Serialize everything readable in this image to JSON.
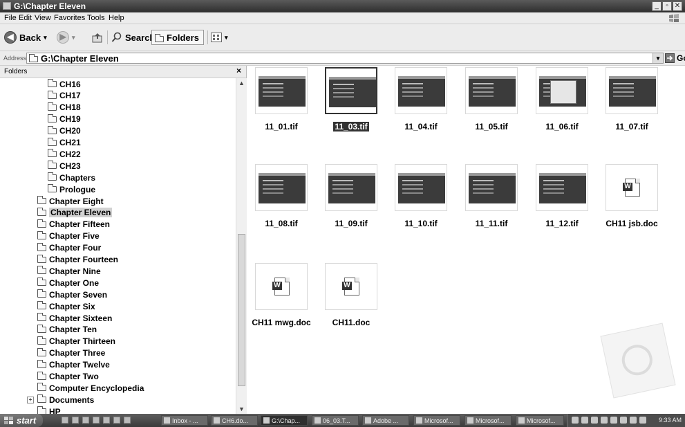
{
  "window": {
    "title": "G:\\Chapter Eleven"
  },
  "menu": [
    "File",
    "Edit",
    "View",
    "Favorites",
    "Tools",
    "Help"
  ],
  "toolbar": {
    "back": "Back",
    "search": "Search",
    "folders": "Folders"
  },
  "address": {
    "label": "Address",
    "value": "G:\\Chapter Eleven",
    "go": "Go"
  },
  "folders_pane": {
    "title": "Folders",
    "items": [
      {
        "label": "CH16",
        "level": 2
      },
      {
        "label": "CH17",
        "level": 2
      },
      {
        "label": "CH18",
        "level": 2
      },
      {
        "label": "CH19",
        "level": 2
      },
      {
        "label": "CH20",
        "level": 2
      },
      {
        "label": "CH21",
        "level": 2
      },
      {
        "label": "CH22",
        "level": 2
      },
      {
        "label": "CH23",
        "level": 2
      },
      {
        "label": "Chapters",
        "level": 2
      },
      {
        "label": "Prologue",
        "level": 2
      },
      {
        "label": "Chapter Eight",
        "level": 1
      },
      {
        "label": "Chapter Eleven",
        "level": 1,
        "selected": true
      },
      {
        "label": "Chapter Fifteen",
        "level": 1
      },
      {
        "label": "Chapter Five",
        "level": 1
      },
      {
        "label": "Chapter Four",
        "level": 1
      },
      {
        "label": "Chapter Fourteen",
        "level": 1
      },
      {
        "label": "Chapter Nine",
        "level": 1
      },
      {
        "label": "Chapter One",
        "level": 1
      },
      {
        "label": "Chapter Seven",
        "level": 1
      },
      {
        "label": "Chapter Six",
        "level": 1
      },
      {
        "label": "Chapter Sixteen",
        "level": 1
      },
      {
        "label": "Chapter Ten",
        "level": 1
      },
      {
        "label": "Chapter Thirteen",
        "level": 1
      },
      {
        "label": "Chapter Three",
        "level": 1
      },
      {
        "label": "Chapter Twelve",
        "level": 1
      },
      {
        "label": "Chapter Two",
        "level": 1
      },
      {
        "label": "Computer Encyclopedia",
        "level": 1
      },
      {
        "label": "Documents",
        "level": 1,
        "expandable": true
      },
      {
        "label": "HP",
        "level": 1
      }
    ]
  },
  "files": [
    {
      "name": "11_01.tif",
      "type": "image"
    },
    {
      "name": "11_03.tif",
      "type": "image",
      "selected": true
    },
    {
      "name": "11_04.tif",
      "type": "image"
    },
    {
      "name": "11_05.tif",
      "type": "image"
    },
    {
      "name": "11_06.tif",
      "type": "image-dialog"
    },
    {
      "name": "11_07.tif",
      "type": "image"
    },
    {
      "name": "11_08.tif",
      "type": "image"
    },
    {
      "name": "11_09.tif",
      "type": "image"
    },
    {
      "name": "11_10.tif",
      "type": "image"
    },
    {
      "name": "11_11.tif",
      "type": "image"
    },
    {
      "name": "11_12.tif",
      "type": "image"
    },
    {
      "name": "CH11 jsb.doc",
      "type": "word-doc"
    },
    {
      "name": "CH11 mwg.doc",
      "type": "word-doc"
    },
    {
      "name": "CH11.doc",
      "type": "word-doc"
    }
  ],
  "taskbar": {
    "start": "start",
    "tasks": [
      {
        "label": "Inbox - ..."
      },
      {
        "label": "CH6.do..."
      },
      {
        "label": "G:\\Chap...",
        "active": true
      },
      {
        "label": "06_03.T..."
      },
      {
        "label": "Adobe ..."
      },
      {
        "label": "Microsof..."
      },
      {
        "label": "Microsof..."
      },
      {
        "label": "Microsof..."
      }
    ],
    "clock": "9:33 AM"
  }
}
